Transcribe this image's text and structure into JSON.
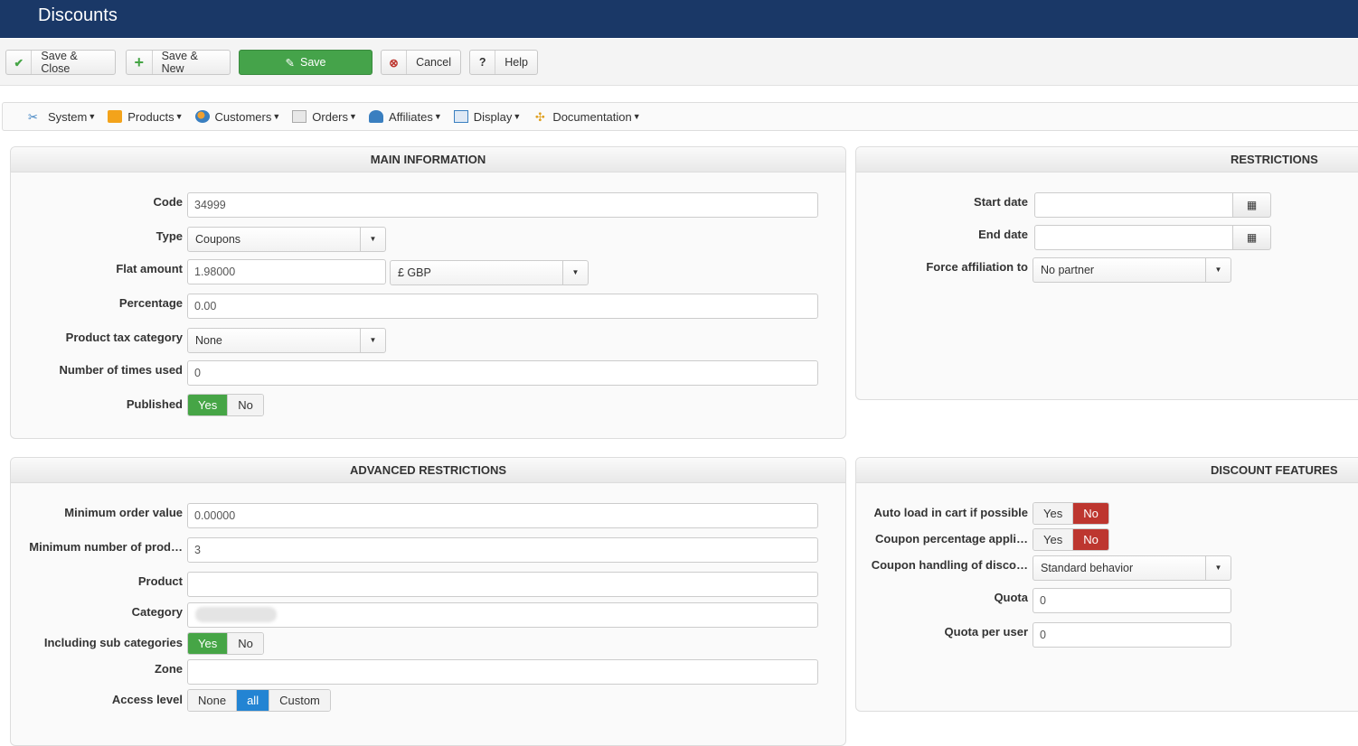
{
  "title": "Discounts",
  "toolbar": {
    "save_close": "Save & Close",
    "save_new": "Save & New",
    "save": "Save",
    "cancel": "Cancel",
    "help": "Help"
  },
  "menu": [
    "System",
    "Products",
    "Customers",
    "Orders",
    "Affiliates",
    "Display",
    "Documentation"
  ],
  "main": {
    "title": "MAIN INFORMATION",
    "code_label": "Code",
    "code": "34999",
    "type_label": "Type",
    "type": "Coupons",
    "flat_label": "Flat amount",
    "flat": "1.98000",
    "currency": "£ GBP",
    "pct_label": "Percentage",
    "pct": "0.00",
    "tax_label": "Product tax category",
    "tax": "None",
    "used_label": "Number of times used",
    "used": "0",
    "pub_label": "Published",
    "yes": "Yes",
    "no": "No"
  },
  "restrictions": {
    "title": "RESTRICTIONS",
    "start_label": "Start date",
    "start": "",
    "end_label": "End date",
    "end": "",
    "aff_label": "Force affiliation to",
    "aff": "No partner"
  },
  "advanced": {
    "title": "ADVANCED RESTRICTIONS",
    "min_order_label": "Minimum order value",
    "min_order": "0.00000",
    "min_prod_label": "Minimum number of prod…",
    "min_prod": "3",
    "product_label": "Product",
    "product": "",
    "category_label": "Category",
    "subcat_label": "Including sub categories",
    "yes": "Yes",
    "no": "No",
    "zone_label": "Zone",
    "zone": "",
    "access_label": "Access level",
    "access": [
      "None",
      "all",
      "Custom"
    ]
  },
  "features": {
    "title": "DISCOUNT FEATURES",
    "auto_label": "Auto load in cart if possible",
    "pctapp_label": "Coupon percentage appli…",
    "yes": "Yes",
    "no": "No",
    "handling_label": "Coupon handling of disco…",
    "handling": "Standard behavior",
    "quota_label": "Quota",
    "quota": "0",
    "quota_user_label": "Quota per user",
    "quota_user": "0"
  }
}
